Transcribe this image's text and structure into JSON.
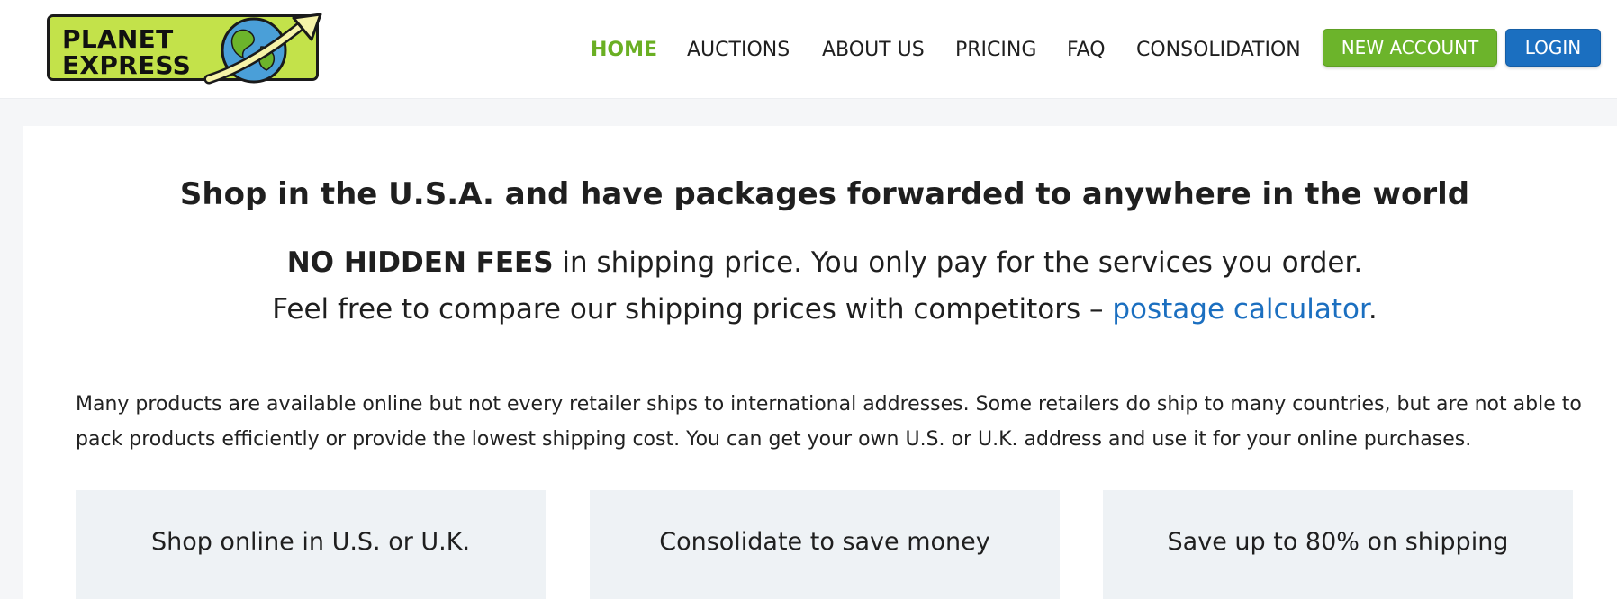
{
  "logo": {
    "line1": "PLANET",
    "line2": "EXPRESS",
    "icon": "globe-with-arrow-icon"
  },
  "nav": {
    "items": [
      {
        "label": "HOME",
        "active": true
      },
      {
        "label": "AUCTIONS",
        "active": false
      },
      {
        "label": "ABOUT US",
        "active": false
      },
      {
        "label": "PRICING",
        "active": false
      },
      {
        "label": "FAQ",
        "active": false
      },
      {
        "label": "CONSOLIDATION",
        "active": false
      }
    ],
    "new_account_label": "NEW ACCOUNT",
    "login_label": "LOGIN"
  },
  "colors": {
    "accent_green": "#6cb42b",
    "active_nav": "#6aaf23",
    "link_blue": "#1b6fc0",
    "logo_bg": "#c3e24a",
    "feature_bg": "#eef2f5"
  },
  "hero": {
    "headline": "Shop in the U.S.A. and have packages forwarded to anywhere in the world",
    "sub1_bold": "NO HIDDEN FEES",
    "sub1_rest": " in shipping price. You only pay for the services you order.",
    "sub2_text": "Feel free to compare our shipping prices with competitors – ",
    "sub2_link": "postage calculator",
    "sub2_end": "."
  },
  "intro": {
    "paragraph": "Many products are available online but not every retailer ships to international addresses. Some retailers do ship to many countries, but are not able to pack products efficiently or provide the lowest shipping cost. You can get your own U.S. or U.K. address and use it for your online purchases."
  },
  "features": [
    {
      "label": "Shop online in U.S. or U.K."
    },
    {
      "label": "Consolidate to save money"
    },
    {
      "label": "Save up to 80% on shipping"
    }
  ]
}
